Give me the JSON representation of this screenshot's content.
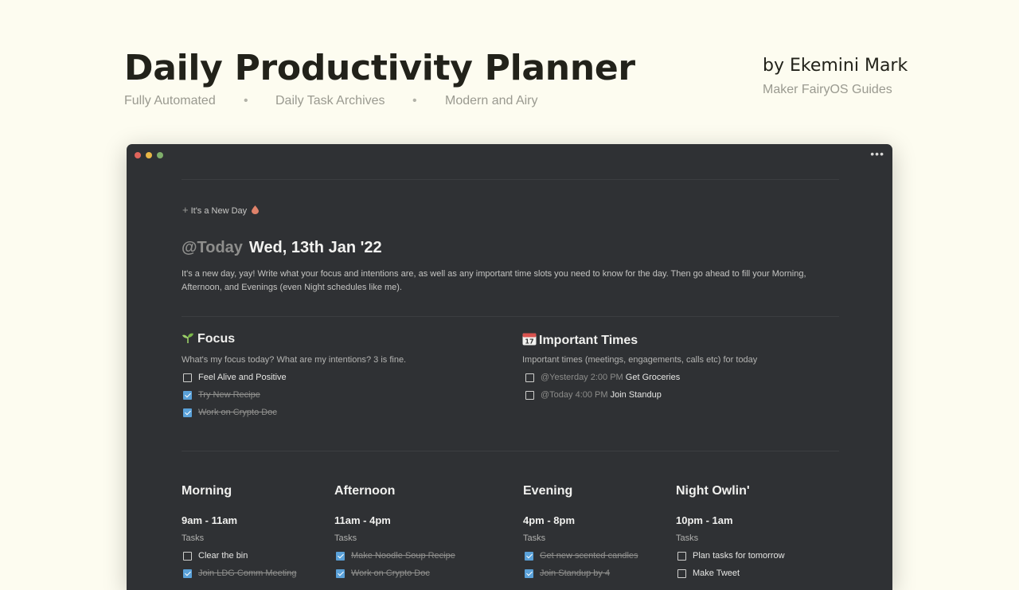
{
  "header": {
    "title": "Daily Productivity Planner",
    "tags": [
      "Fully Automated",
      "•",
      "Daily Task Archives",
      "•",
      "Modern and Airy"
    ],
    "author": "by Ekemini Mark",
    "author_sub": "Maker FairyOS Guides"
  },
  "window": {
    "more_label": "•••",
    "new_day_label": "It's a New Day",
    "date_mention": "@Today",
    "date": "Wed, 13th Jan '22",
    "intro": "It's a new day, yay! Write what your focus and intentions are, as well as any important time slots you need to know for the day. Then go ahead to fill your Morning, Afternoon, and Evenings (even Night schedules like me).",
    "focus": {
      "title": "Focus",
      "subtitle": "What's my focus today? What are my intentions? 3 is fine.",
      "items": [
        {
          "label": "Feel Alive and Positive",
          "done": false
        },
        {
          "label": "Try New Recipe",
          "done": true
        },
        {
          "label": "Work on Crypto Doc",
          "done": true
        }
      ]
    },
    "important": {
      "title": "Important Times",
      "subtitle": "Important times (meetings, engagements, calls etc) for today",
      "items": [
        {
          "when": "@Yesterday 2:00 PM",
          "label": "Get Groceries",
          "done": false
        },
        {
          "when": "@Today 4:00 PM",
          "label": "Join Standup",
          "done": false
        }
      ]
    },
    "blocks": [
      {
        "title": "Morning",
        "time": "9am - 11am",
        "tasks_label": "Tasks",
        "first_task": "Clear the bin",
        "first_done": false,
        "second_task": "Join LDG Comm Meeting"
      },
      {
        "title": "Afternoon",
        "time": "11am - 4pm",
        "tasks_label": "Tasks",
        "first_task": "Make Noodle Soup Recipe",
        "first_done": true,
        "second_task": "Work on Crypto Doc"
      },
      {
        "title": "Evening",
        "time": "4pm - 8pm",
        "tasks_label": "Tasks",
        "first_task": "Get new scented candles",
        "first_done": true,
        "second_task": "Join Standup by 4"
      },
      {
        "title": "Night Owlin'",
        "time": "10pm - 1am",
        "tasks_label": "Tasks",
        "first_task": "Plan tasks for tomorrow",
        "first_done": false,
        "second_task": "Make Tweet"
      }
    ],
    "colors": {
      "window_bg": "#2f3134",
      "check_blue": "#5aa1d9",
      "page_bg": "#fdfcf0"
    }
  }
}
